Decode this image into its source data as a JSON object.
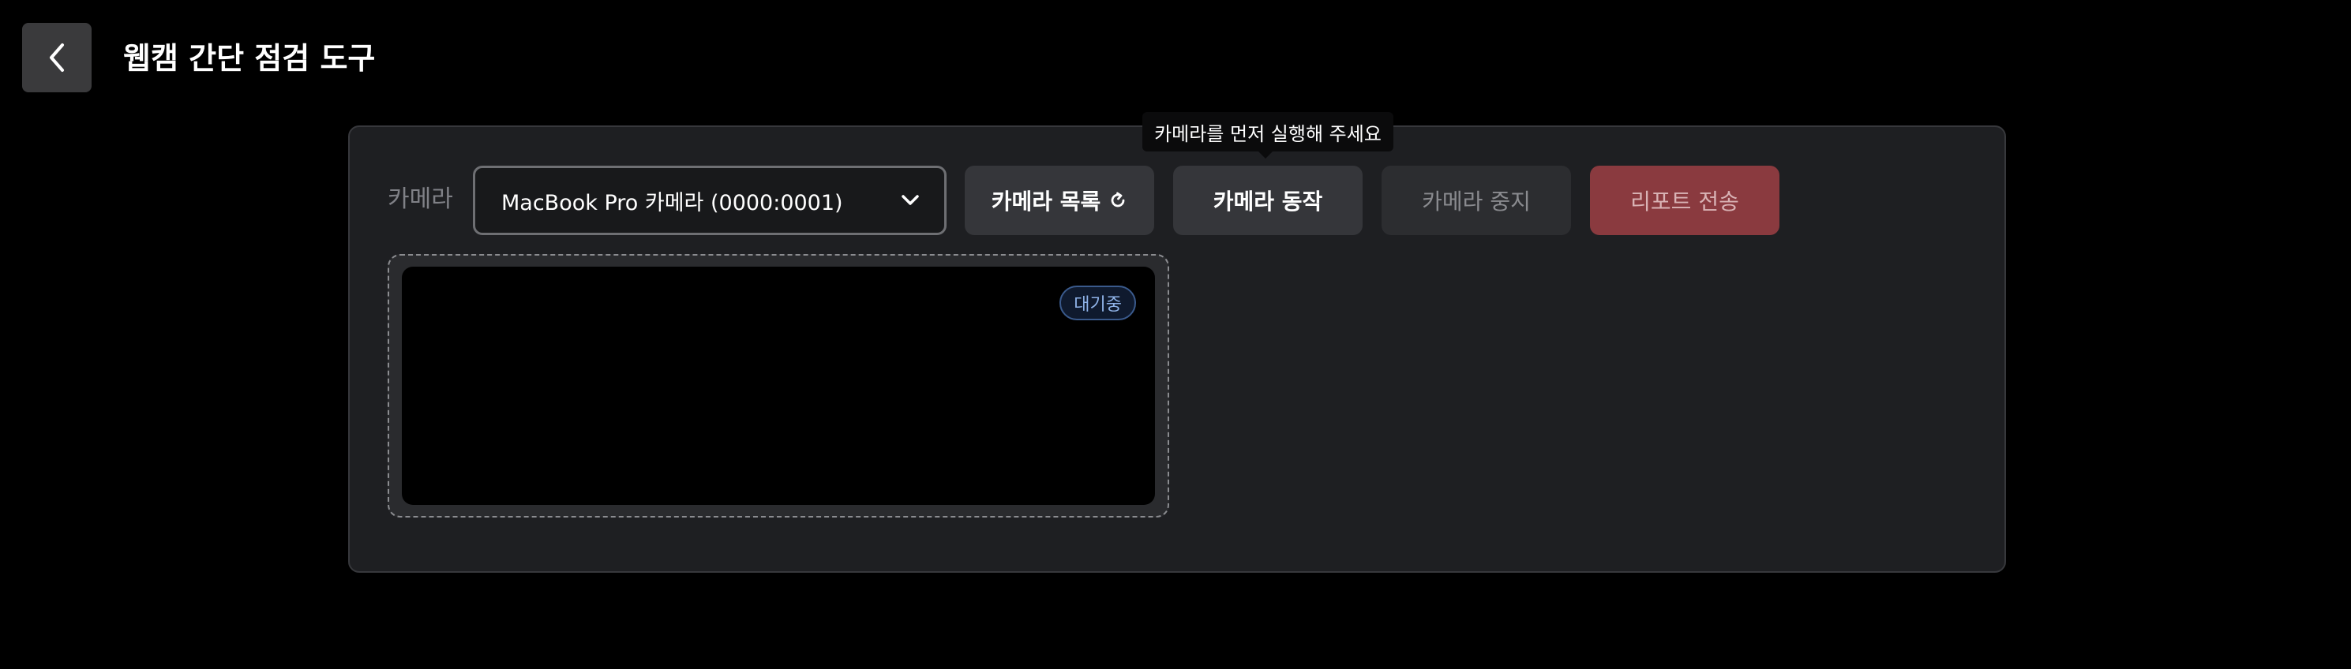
{
  "header": {
    "back_icon": "chevron-left-icon",
    "title": "웹캠 간단 점검 도구"
  },
  "controls": {
    "camera_label": "카메라",
    "camera_select_value": "MacBook Pro 카메라 (0000:0001)",
    "select_icon": "chevron-down-icon",
    "list_button_label": "카메라 목록",
    "refresh_icon": "refresh-icon",
    "start_button_label": "카메라 동작",
    "stop_button_label": "카메라 중지",
    "report_button_label": "리포트 전송",
    "tooltip_text": "카메라를 먼저 실행해 주세요"
  },
  "preview": {
    "status_badge": "대기중"
  },
  "colors": {
    "background": "#000000",
    "panel": "#1e1f22",
    "button": "#35363a",
    "report_button": "#8a3a3f",
    "badge_text": "#8fb3e8"
  }
}
